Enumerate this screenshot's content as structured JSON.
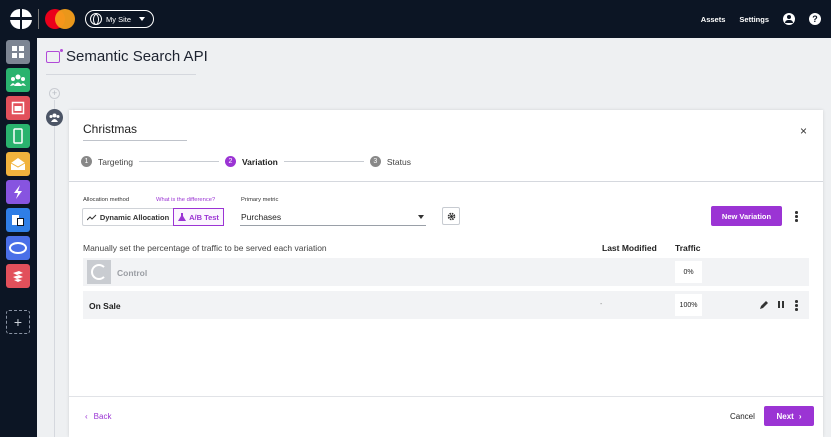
{
  "topbar": {
    "site_label": "My Site",
    "nav": [
      "Assets",
      "Settings"
    ],
    "help_glyph": "?"
  },
  "rail": {
    "items": [
      {
        "icon": "dashboard-icon",
        "color": "#7d8593"
      },
      {
        "icon": "audience-icon",
        "color": "#2ab36e"
      },
      {
        "icon": "layout-icon",
        "color": "#e2505b"
      },
      {
        "icon": "mobile-icon",
        "color": "#2ab36e"
      },
      {
        "icon": "email-icon",
        "color": "#f1b33d"
      },
      {
        "icon": "bolt-icon",
        "color": "#8754e0"
      },
      {
        "icon": "pages-icon",
        "color": "#2f7ee6"
      },
      {
        "icon": "eye-icon",
        "color": "#4a6fe8"
      },
      {
        "icon": "stack-icon",
        "color": "#e2505b"
      }
    ],
    "add_glyph": "+"
  },
  "page": {
    "title": "Semantic Search API",
    "plus_glyph": "+"
  },
  "panel": {
    "name": "Christmas",
    "close_glyph": "×",
    "steps": [
      {
        "num": "1",
        "label": "Targeting",
        "active": false
      },
      {
        "num": "2",
        "label": "Variation",
        "active": true
      },
      {
        "num": "3",
        "label": "Status",
        "active": false
      }
    ],
    "allocation": {
      "label": "Allocation method",
      "help_link": "What is the difference?",
      "dynamic_label": "Dynamic Allocation",
      "ab_label": "A/B Test"
    },
    "metric": {
      "label": "Primary metric",
      "value": "Purchases"
    },
    "new_variation_label": "New Variation",
    "table": {
      "caption": "Manually set the percentage of traffic to be served each variation",
      "col_last_modified": "Last Modified",
      "col_traffic": "Traffic",
      "rows": [
        {
          "name": "Control",
          "last_modified": "",
          "traffic": "0%"
        },
        {
          "name": "On Sale",
          "last_modified": "-",
          "traffic": "100%"
        }
      ]
    },
    "footer": {
      "back_label": "Back",
      "back_glyph": "‹",
      "cancel_label": "Cancel",
      "next_label": "Next",
      "next_glyph": "›"
    }
  },
  "colors": {
    "accent": "#9b34d4",
    "topbar": "#0c1524"
  }
}
